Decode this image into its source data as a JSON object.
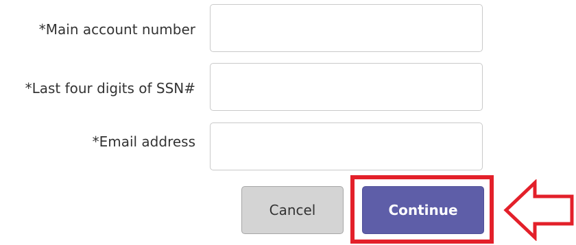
{
  "form": {
    "fields": [
      {
        "label": "*Main account number",
        "value": "",
        "placeholder": ""
      },
      {
        "label": "*Last four digits of SSN#",
        "value": "",
        "placeholder": ""
      },
      {
        "label": "*Email address",
        "value": "",
        "placeholder": ""
      }
    ],
    "cancel_label": "Cancel",
    "continue_label": "Continue"
  },
  "annotation": {
    "highlight_color": "#e3202a",
    "arrow_icon": "left-arrow-outline-icon"
  },
  "colors": {
    "continue_button": "#5e5ea8",
    "cancel_button": "#d4d4d4"
  }
}
